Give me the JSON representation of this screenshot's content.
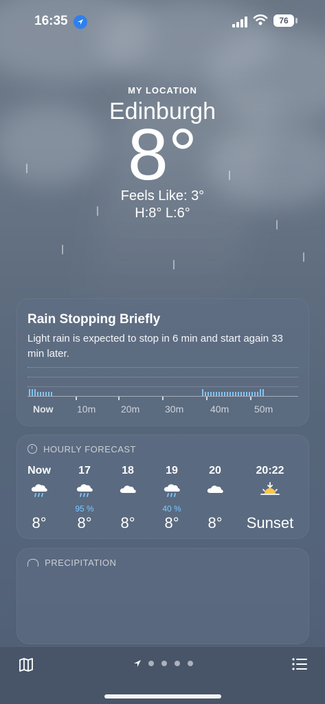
{
  "status_bar": {
    "time": "16:35",
    "battery": "76"
  },
  "header": {
    "location_label": "MY LOCATION",
    "city": "Edinburgh",
    "temperature": "8°",
    "feels_like": "Feels Like: 3°",
    "high_low": "H:8°  L:6°"
  },
  "rain_card": {
    "title": "Rain Stopping Briefly",
    "description": "Light rain is expected to stop in 6 min and start again 33 min later.",
    "x_labels": [
      "Now",
      "10m",
      "20m",
      "30m",
      "40m",
      "50m"
    ]
  },
  "hourly": {
    "heading": "HOURLY FORECAST",
    "items": [
      {
        "time": "Now",
        "icon": "cloud-rain-icon",
        "prob": "",
        "temp": "8°"
      },
      {
        "time": "17",
        "icon": "cloud-rain-icon",
        "prob": "95 %",
        "temp": "8°"
      },
      {
        "time": "18",
        "icon": "cloud-icon",
        "prob": "",
        "temp": "8°"
      },
      {
        "time": "19",
        "icon": "cloud-rain-icon",
        "prob": "40 %",
        "temp": "8°"
      },
      {
        "time": "20",
        "icon": "cloud-icon",
        "prob": "",
        "temp": "8°"
      },
      {
        "time": "20:22",
        "icon": "sunset-icon",
        "prob": "",
        "temp": "Sunset"
      }
    ]
  },
  "precipitation": {
    "heading": "PRECIPITATION"
  },
  "colors": {
    "accent_blue": "#2f80ed",
    "rain_blue": "#83c4f2",
    "percent_blue": "#7ec8ff"
  }
}
